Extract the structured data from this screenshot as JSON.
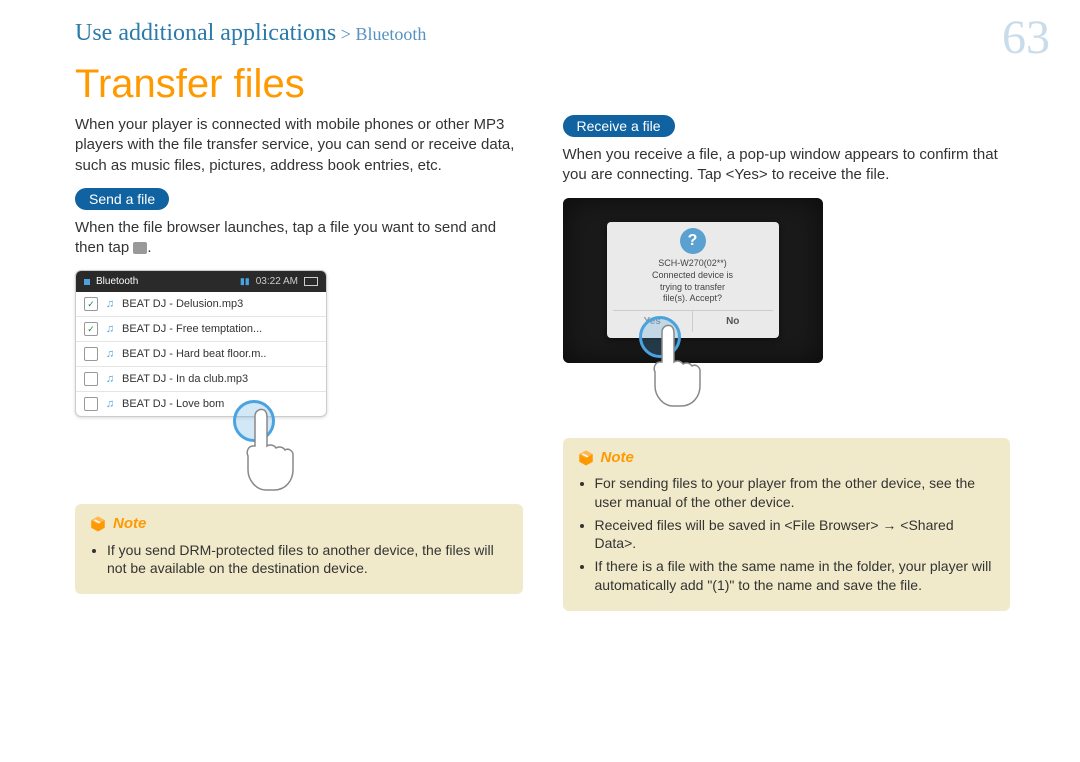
{
  "breadcrumb": {
    "main": "Use additional applications",
    "separator": " > ",
    "sub": "Bluetooth"
  },
  "page_number": "63",
  "title": "Transfer files",
  "intro_text": "When your player is connected with mobile phones or other MP3 players with the file transfer service, you can send or receive data, such as music files, pictures, address book entries, etc.",
  "send": {
    "pill": "Send a file",
    "text_before_icon": "When the file browser launches, tap a file you want to send and then tap ",
    "text_after_icon": ".",
    "device_header": {
      "title": "Bluetooth",
      "time": "03:22 AM"
    },
    "files": [
      {
        "checked": true,
        "name": "BEAT DJ - Delusion.mp3"
      },
      {
        "checked": true,
        "name": "BEAT DJ - Free temptation..."
      },
      {
        "checked": false,
        "name": "BEAT DJ - Hard beat floor.m.."
      },
      {
        "checked": false,
        "name": "BEAT DJ - In da club.mp3"
      },
      {
        "checked": false,
        "name": "BEAT DJ - Love bom"
      }
    ],
    "note_label": "Note",
    "note_items": [
      "If you send DRM-protected files to another device, the files will not be available on the destination device."
    ]
  },
  "receive": {
    "pill": "Receive a file",
    "text": "When you receive a file, a pop-up window appears to confirm that you are connecting. Tap <Yes> to receive the file.",
    "dialog": {
      "line1": "SCH-W270(02**)",
      "line2": "Connected device is",
      "line3": "trying to transfer",
      "line4": "file(s). Accept?",
      "yes": "Yes",
      "no": "No"
    },
    "note_label": "Note",
    "note_items": [
      "For sending files to your player from the other device, see the user manual of the other device.",
      "Received files will be saved in <File Browser> → <Shared Data>.",
      "If there is a file with the same name in the folder, your player will automatically add \"(1)\" to the name and save the file."
    ]
  }
}
